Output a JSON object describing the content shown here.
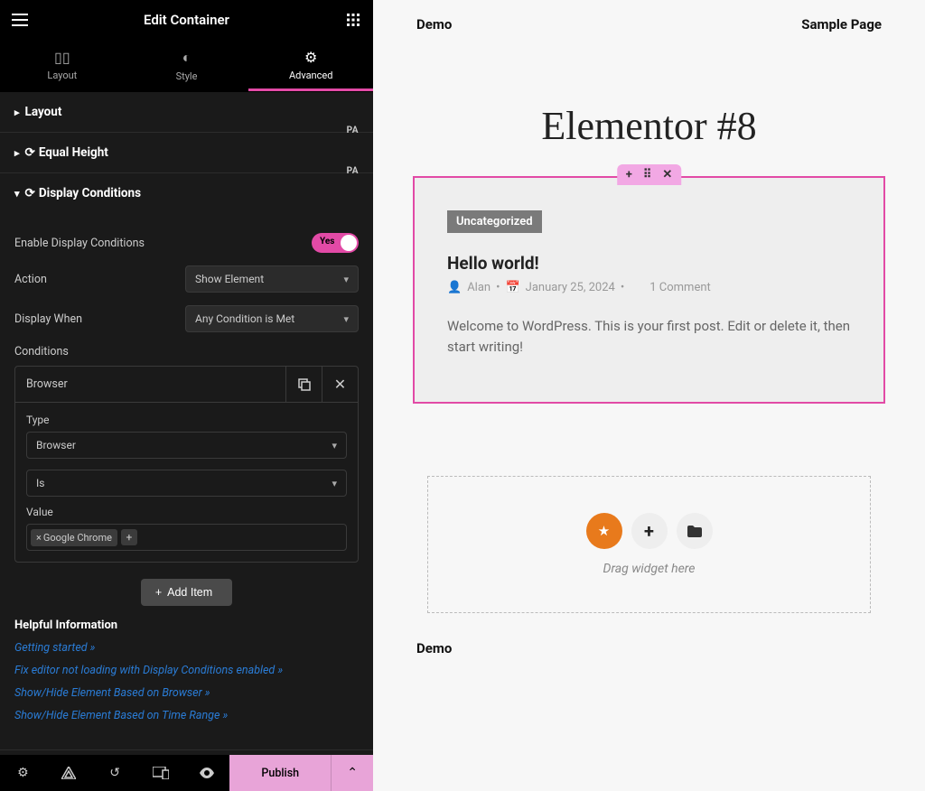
{
  "header": {
    "title": "Edit Container"
  },
  "tabs": {
    "layout": "Layout",
    "style": "Style",
    "advanced": "Advanced"
  },
  "sections": {
    "layout_label": "Layout",
    "equal_height_label": "Equal Height",
    "display_conditions_label": "Display Conditions",
    "pa_badge": "PA"
  },
  "display_conditions": {
    "enable_label": "Enable Display Conditions",
    "enable_value": "Yes",
    "action_label": "Action",
    "action_value": "Show Element",
    "display_when_label": "Display When",
    "display_when_value": "Any Condition is Met",
    "conditions_label": "Conditions",
    "condition_name": "Browser",
    "type_label": "Type",
    "type_value": "Browser",
    "operator_value": "Is",
    "value_label": "Value",
    "value_tag": "Google Chrome",
    "add_item": "Add Item"
  },
  "help": {
    "heading": "Helpful Information",
    "links": [
      "Getting started »",
      "Fix editor not loading with Display Conditions enabled »",
      "Show/Hide Element Based on Browser »",
      "Show/Hide Element Based on Time Range »"
    ]
  },
  "footer": {
    "publish": "Publish"
  },
  "nav": {
    "demo": "Demo",
    "sample": "Sample Page"
  },
  "page": {
    "title": "Elementor #8"
  },
  "post": {
    "category": "Uncategorized",
    "title": "Hello world!",
    "author": "Alan",
    "date": "January 25, 2024",
    "comments": "1 Comment",
    "body": "Welcome to WordPress. This is your first post. Edit or delete it, then start writing!"
  },
  "dropzone": {
    "label": "Drag widget here"
  },
  "bottom": {
    "demo": "Demo"
  }
}
